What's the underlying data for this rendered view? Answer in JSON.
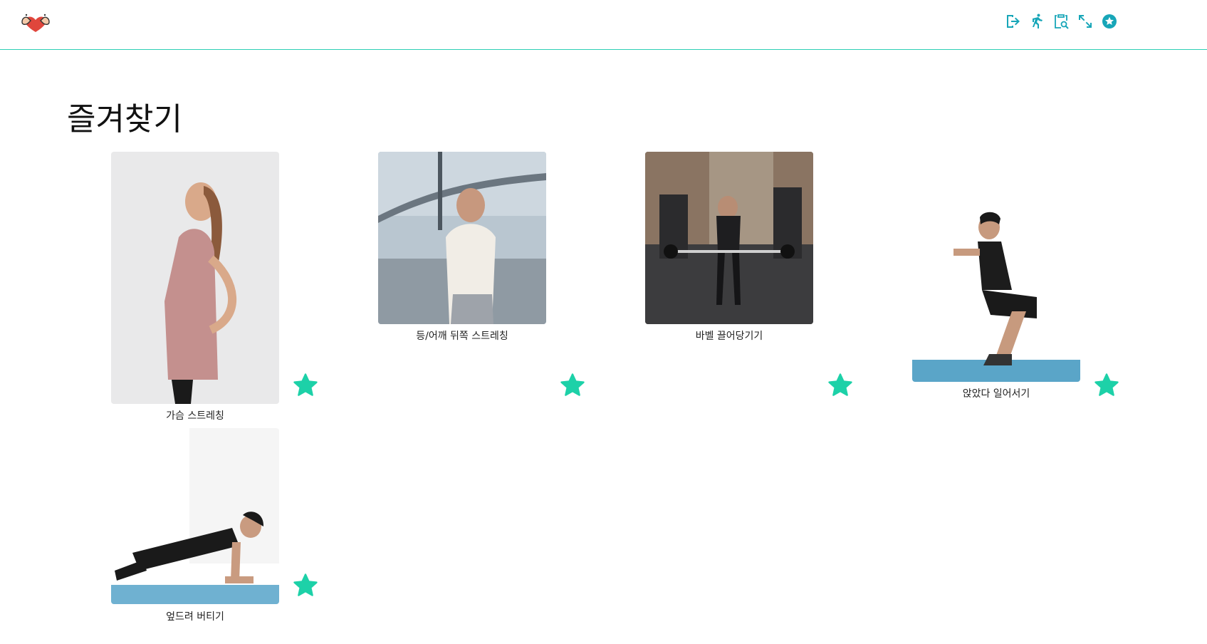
{
  "header": {
    "nav": [
      {
        "icon": "logout-icon",
        "label": ""
      },
      {
        "icon": "running-icon",
        "label": ""
      },
      {
        "icon": "clipboard-search-icon",
        "label": ""
      },
      {
        "icon": "expand-icon",
        "label": ""
      },
      {
        "icon": "star-circle-icon",
        "label": ""
      }
    ]
  },
  "page": {
    "title": "즐겨찾기"
  },
  "favorites": [
    {
      "name": "가슴 스트레칭",
      "favorited": true
    },
    {
      "name": "등/어깨 뒤쪽 스트레칭",
      "favorited": true
    },
    {
      "name": "바벨 끌어당기기",
      "favorited": true
    },
    {
      "name": "앉았다 일어서기",
      "favorited": true
    },
    {
      "name": "엎드려 버티기",
      "favorited": true
    }
  ],
  "colors": {
    "accent": "#1dd1a8",
    "icon": "#17a6b8",
    "divider": "#2ecfb4"
  }
}
